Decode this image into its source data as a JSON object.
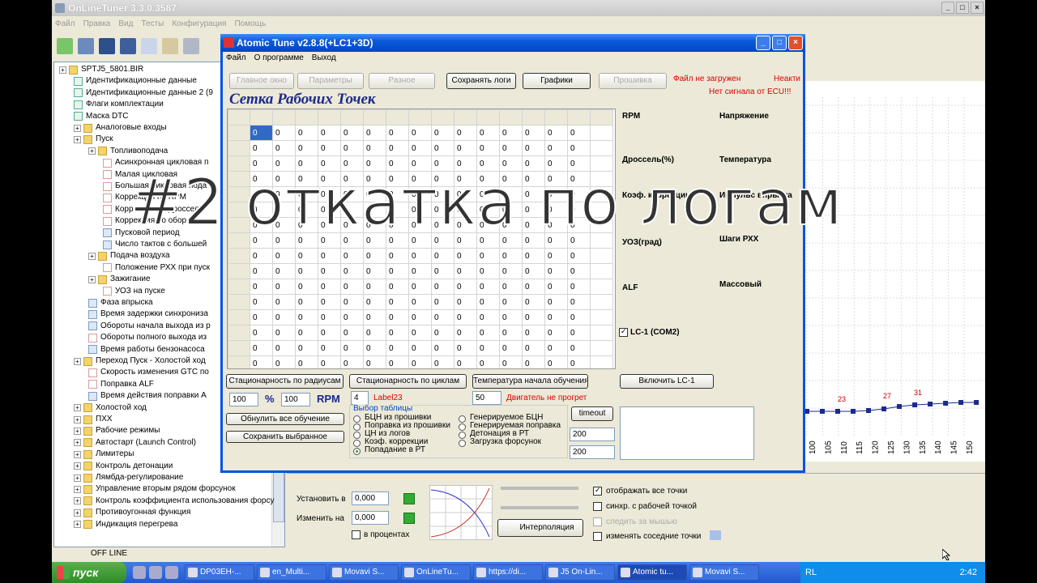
{
  "main": {
    "title": "OnLineTuner 3.3.0.3587",
    "menu": [
      "Файл",
      "Правка",
      "Вид",
      "Тесты",
      "Конфигурация",
      "Помощь"
    ],
    "status": "OFF LINE"
  },
  "tree": [
    {
      "label": "SPTJ5_5801.BIR",
      "level": 0,
      "icon": "folder-icon"
    },
    {
      "label": "Идентификационные данные",
      "level": 1,
      "icon": "check-icon"
    },
    {
      "label": "Идентификационные данные 2 (9",
      "level": 1,
      "icon": "check-icon"
    },
    {
      "label": "Флаги комплектации",
      "level": 1,
      "icon": "check-icon"
    },
    {
      "label": "Маска DTC",
      "level": 1,
      "icon": "check-icon"
    },
    {
      "label": "Аналоговые входы",
      "level": 1,
      "icon": "folder-icon"
    },
    {
      "label": "Пуск",
      "level": 1,
      "icon": "folder-icon"
    },
    {
      "label": "Топливоподача",
      "level": 2,
      "icon": "folder-icon"
    },
    {
      "label": "Асинхронная цикловая п",
      "level": 3,
      "icon": "chart-icon"
    },
    {
      "label": "Малая цикловая",
      "level": 3,
      "icon": "chart-icon"
    },
    {
      "label": "Большая цикловая пода",
      "level": 3,
      "icon": "chart-icon"
    },
    {
      "label": "Коррекция по RPM",
      "level": 3,
      "icon": "chart-icon"
    },
    {
      "label": "Коррекция по дросселю",
      "level": 3,
      "icon": "chart-icon"
    },
    {
      "label": "Коррекция по обор",
      "level": 3,
      "icon": "chart-icon"
    },
    {
      "label": "Пусковой период",
      "level": 3,
      "icon": "number-icon"
    },
    {
      "label": "Число тактов с большей",
      "level": 3,
      "icon": "number-icon"
    },
    {
      "label": "Подача воздуха",
      "level": 2,
      "icon": "folder-icon"
    },
    {
      "label": "Положение РХХ при пуск",
      "level": 3,
      "icon": "chart-icon"
    },
    {
      "label": "Зажигание",
      "level": 2,
      "icon": "folder-icon"
    },
    {
      "label": "УОЗ на пуске",
      "level": 3,
      "icon": "chart-icon"
    },
    {
      "label": "Фаза впрыска",
      "level": 2,
      "icon": "number-icon"
    },
    {
      "label": "Время задержки синхрониза",
      "level": 2,
      "icon": "number-icon"
    },
    {
      "label": "Обороты начала выхода из р",
      "level": 2,
      "icon": "number-icon"
    },
    {
      "label": "Обороты полного выхода из",
      "level": 2,
      "icon": "chart-icon"
    },
    {
      "label": "Время работы бензонасоса",
      "level": 2,
      "icon": "number-icon"
    },
    {
      "label": "Переход Пуск - Холостой ход",
      "level": 1,
      "icon": "folder-icon"
    },
    {
      "label": "Скорость изменения GTC по",
      "level": 2,
      "icon": "chart-icon"
    },
    {
      "label": "Поправка ALF",
      "level": 2,
      "icon": "chart-icon"
    },
    {
      "label": "Время действия поправки А",
      "level": 2,
      "icon": "number-icon"
    },
    {
      "label": "Холостой ход",
      "level": 1,
      "icon": "folder-icon"
    },
    {
      "label": "ПХХ",
      "level": 1,
      "icon": "folder-icon"
    },
    {
      "label": "Рабочие режимы",
      "level": 1,
      "icon": "folder-icon"
    },
    {
      "label": "Автостарт (Launch Control)",
      "level": 1,
      "icon": "folder-icon"
    },
    {
      "label": "Лимитеры",
      "level": 1,
      "icon": "folder-icon"
    },
    {
      "label": "Контроль детонации",
      "level": 1,
      "icon": "folder-icon"
    },
    {
      "label": "Лямбда-регулирование",
      "level": 1,
      "icon": "folder-icon"
    },
    {
      "label": "Управление вторым рядом форсунок",
      "level": 1,
      "icon": "folder-icon"
    },
    {
      "label": "Контроль коэффициента использования форсу",
      "level": 1,
      "icon": "folder-icon"
    },
    {
      "label": "Противоугонная функция",
      "level": 1,
      "icon": "folder-icon"
    },
    {
      "label": "Индикация перегрева",
      "level": 1,
      "icon": "folder-icon"
    }
  ],
  "bottom_panel": {
    "set_label": "Установить в",
    "set_value": "0,000",
    "change_label": "Изменить на",
    "change_value": "0,000",
    "percent_label": "в процентах",
    "interp_label": "Интерполяция",
    "show_all": "отображать все точки",
    "sync": "синхр. с рабочей точкой",
    "follow": "следить за мышью",
    "neighbors": "изменять соседние точки"
  },
  "chart_area": {
    "x_ticks": [
      "100",
      "105",
      "110",
      "115",
      "120",
      "125",
      "130",
      "135",
      "140",
      "145",
      "150"
    ],
    "point_labels": [
      "23",
      "27",
      "31"
    ]
  },
  "atomic": {
    "title": "Atomic Tune  v2.8.8(+LC1+3D)",
    "menu": [
      "Файл",
      "О программе",
      "Выход"
    ],
    "top_buttons": [
      {
        "label": "Главное окно",
        "enabled": false
      },
      {
        "label": "Параметры",
        "enabled": false
      },
      {
        "label": "Разное",
        "enabled": false
      },
      {
        "label": "Сохранять логи",
        "enabled": true
      },
      {
        "label": "Графики",
        "enabled": true
      },
      {
        "label": "Прошивка",
        "enabled": false
      }
    ],
    "status_red1": "Файл не загружен",
    "status_red2": "Неакти",
    "status_red3": "Нет сигнала от ECU!!!",
    "grid_title": "Сетка Рабочих Точек",
    "side_labels": [
      "RPM",
      "Напряжение",
      "Дроссель(%)",
      "Температура",
      "Коэф. коррекции",
      "Импульс впрыска",
      "УОЗ(град)",
      "Шаги РХХ",
      "ALF",
      "Массовый"
    ],
    "lc1_label": "LC-1 (COM2)",
    "btn_stat_radius": "Стационарность по радиусам",
    "btn_stat_cycles": "Стационарность по циклам",
    "btn_temp": "Температура начала обучения",
    "btn_lc1": "Включить LC-1",
    "pct1": "100",
    "pct_sym": "%",
    "pct2": "100",
    "rpm": "RPM",
    "cycles_val": "4",
    "label23": "Label23",
    "temp_val": "50",
    "engine_cold": "Двигатель не прогрет",
    "reset_btn": "Обнулить все обучение",
    "save_btn": "Сохранить выбранное",
    "table_select": "Выбор таблицы",
    "radios_left": [
      "БЦН из прошивки",
      "Поправка из прошивки",
      "ЦН из логов",
      "Коэф. коррекции",
      "Попадание в РТ"
    ],
    "radios_right": [
      "Генерируемое БЦН",
      "Генерируемая поправка",
      "Детонация в РТ",
      "Загрузка форсунок"
    ],
    "timeout_label": "timeout",
    "val200a": "200",
    "val200b": "200",
    "grid_value": "0"
  },
  "overlay": "#2 откатка по логам",
  "taskbar": {
    "start": "пуск",
    "tasks": [
      "DP03EH-...",
      "en_Multi...",
      "Movavi S...",
      "OnLineTu...",
      "https://di...",
      "J5 On-Lin...",
      "Atomic tu...",
      "Movavi S..."
    ],
    "lang": "RL",
    "time": "2:42"
  }
}
